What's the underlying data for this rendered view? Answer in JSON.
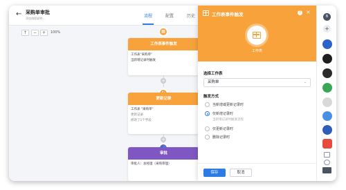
{
  "app": {
    "title": "采购单审批",
    "subtitle": "添加流程说明..."
  },
  "tabs": [
    {
      "label": "流程",
      "active": true
    },
    {
      "label": "配置",
      "active": false
    },
    {
      "label": "历史",
      "active": false
    }
  ],
  "toolbar": {
    "upload_label": "↑",
    "zoom_out_label": "−",
    "zoom_in_label": "+",
    "zoom": "100%"
  },
  "canvas": {
    "nodes": [
      {
        "title": "工作表事件触发",
        "color": "#f7a23a",
        "icon": "table-icon",
        "lines": [
          "工作表\"采购单\"",
          "当新增记录时触发"
        ]
      },
      {
        "title": "更新记录",
        "color": "#f7a23a",
        "icon": "refresh-icon",
        "lines": [
          "工作表 \"采购单\"",
          "更新记录",
          "修改了1个字段"
        ]
      },
      {
        "title": "审批",
        "color": "#7e57c2",
        "icon": "people-icon",
        "lines": [
          "审批人：总经理（采购审理）"
        ]
      }
    ]
  },
  "panel": {
    "title": "工作表事件触发",
    "icon_label": "工作表",
    "help": "?",
    "close": "×",
    "worksheet_label": "选择工作表",
    "worksheet_value": "采购单",
    "trigger_label": "触发方式",
    "options": [
      {
        "label": "当新增或更新记录时",
        "checked": false,
        "hint": ""
      },
      {
        "label": "仅新增记录时",
        "checked": true,
        "hint": "当新增记录时触发流程"
      },
      {
        "label": "仅更新记录时",
        "checked": false,
        "hint": ""
      },
      {
        "label": "删除记录时",
        "checked": false,
        "hint": ""
      }
    ],
    "save_label": "保存",
    "cancel_label": "取消",
    "accent_color": "#f7a23a",
    "primary_color": "#2d7be5"
  },
  "rail": {
    "badge": "B",
    "add": "+"
  }
}
